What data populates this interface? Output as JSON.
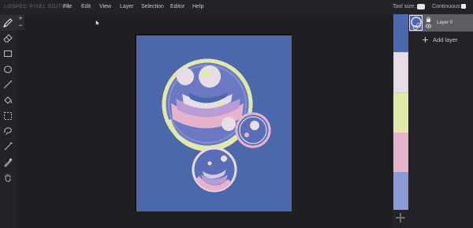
{
  "app": {
    "title": "LOSPEC PIXEL EDITOR"
  },
  "menu": [
    "File",
    "Edit",
    "View",
    "Layer",
    "Selection",
    "Editor",
    "Help"
  ],
  "options": {
    "tool_size_label": "Tool size:",
    "continuous_label": "Continuous:",
    "continuous_checked": false
  },
  "tools": [
    {
      "name": "brush-tool",
      "icon": "pencil-icon",
      "active": true
    },
    {
      "name": "eraser-tool",
      "icon": "eraser-icon"
    },
    {
      "name": "rectangle-tool",
      "icon": "rectangle-icon"
    },
    {
      "name": "ellipse-tool",
      "icon": "ellipse-icon"
    },
    {
      "name": "line-tool",
      "icon": "line-icon"
    },
    {
      "name": "fill-tool",
      "icon": "bucket-icon"
    },
    {
      "name": "select-tool",
      "icon": "selection-icon"
    },
    {
      "name": "lasso-tool",
      "icon": "lasso-icon"
    },
    {
      "name": "magic-wand-tool",
      "icon": "magic-wand-icon"
    },
    {
      "name": "eyedropper-tool",
      "icon": "eyedropper-icon"
    },
    {
      "name": "pan-tool",
      "icon": "hand-icon"
    }
  ],
  "size_controls": {
    "increase": "+",
    "decrease": "−"
  },
  "palette": [
    "#4a68ab",
    "#e6dde6",
    "#e2e8a8",
    "#e5b3cb",
    "#8c9ad8"
  ],
  "palette_selected_index": 1,
  "layers": {
    "items": [
      {
        "name": "Layer 0",
        "locked": true,
        "visible": true
      }
    ],
    "add_label": "Add layer"
  },
  "canvas": {
    "background": "#4a68ab"
  }
}
